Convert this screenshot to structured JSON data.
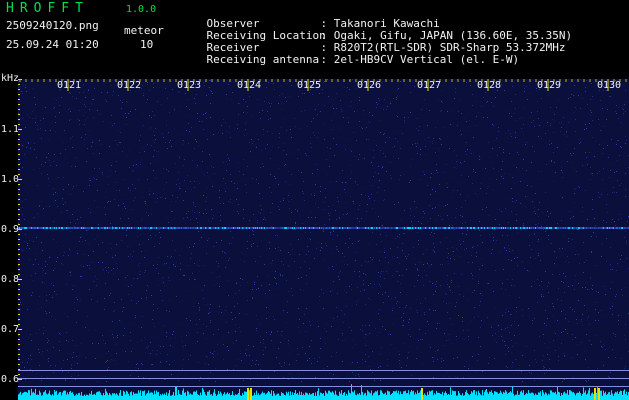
{
  "app": {
    "title": "HROFFT",
    "version": "1.0.0",
    "file_name": "2509240120.png",
    "date_time": "25.09.24 01:20",
    "meteor_label": "meteor",
    "meteor_count": "10"
  },
  "info": [
    {
      "key": "Observer",
      "value": ": Takanori Kawachi"
    },
    {
      "key": "Receiving Location",
      "value": ": Ogaki, Gifu, JAPAN (136.60E, 35.35N)"
    },
    {
      "key": "Receiver",
      "value": ": R820T2(RTL-SDR) SDR-Sharp 53.372MHz"
    },
    {
      "key": "Receiving antenna",
      "value": ": 2el-HB9CV Vertical (el. E-W)"
    }
  ],
  "axis": {
    "y_unit": "kHz",
    "y_ticks": [
      "1.1",
      "1.0",
      "0.9",
      "0.8",
      "0.7",
      "0.6"
    ],
    "x_ticks": [
      "0121",
      "0122",
      "0123",
      "0124",
      "0125",
      "0126",
      "0127",
      "0128",
      "0129",
      "0130"
    ]
  },
  "colors": {
    "background": "#0a0f3c",
    "title_green": "#00e04a",
    "tick_yellow": "#e8e000",
    "signal_cyan": "#00e0ff"
  }
}
